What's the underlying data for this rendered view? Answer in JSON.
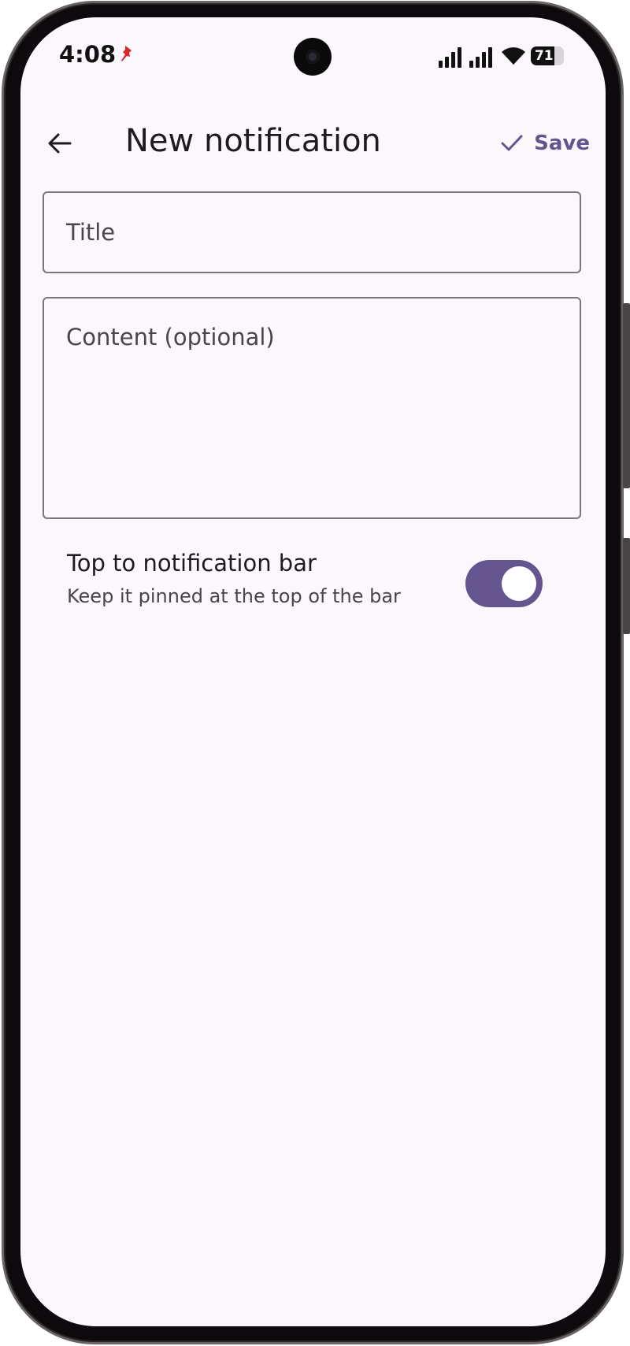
{
  "status_bar": {
    "time": "4:08",
    "battery_level": "71",
    "battery_fraction": 0.71,
    "icons": [
      "pin-icon",
      "signal-icon",
      "signal-icon",
      "wifi-icon",
      "battery-icon"
    ]
  },
  "app_bar": {
    "back_icon": "arrow-back-icon",
    "title": "New notification",
    "save_label": "Save",
    "save_icon": "check-icon"
  },
  "form": {
    "title_placeholder": "Title",
    "title_value": "",
    "content_placeholder": "Content (optional)",
    "content_value": ""
  },
  "pin_setting": {
    "title": "Top to notification bar",
    "subtitle": "Keep it pinned at the top of the bar",
    "enabled": true
  },
  "colors": {
    "accent": "#65558f",
    "background": "#fcf7fc",
    "outline": "#79747e",
    "on_surface": "#1d1b20",
    "on_surface_variant": "#49454f",
    "pin_red": "#d9262c"
  }
}
